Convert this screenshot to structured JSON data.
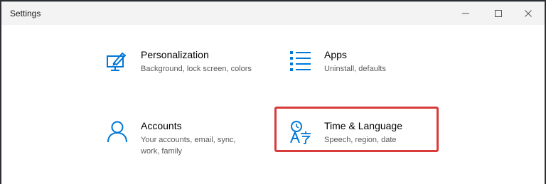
{
  "window": {
    "title": "Settings",
    "controls": {
      "minimize_icon": "minimize-icon",
      "maximize_icon": "maximize-icon",
      "close_icon": "close-icon"
    }
  },
  "tiles": [
    {
      "title": "Personalization",
      "description": "Background, lock screen, colors",
      "icon": "personalization-icon"
    },
    {
      "title": "Apps",
      "description": "Uninstall, defaults",
      "icon": "apps-icon"
    },
    {
      "title": "Accounts",
      "description_lines": [
        "Your accounts, email, sync,",
        "work, family"
      ],
      "icon": "person-icon"
    },
    {
      "title": "Time & Language",
      "description": "Speech, region, date",
      "icon": "time-language-icon"
    }
  ],
  "colors": {
    "accent": "#0078d7",
    "highlight": "#d93a3a"
  }
}
